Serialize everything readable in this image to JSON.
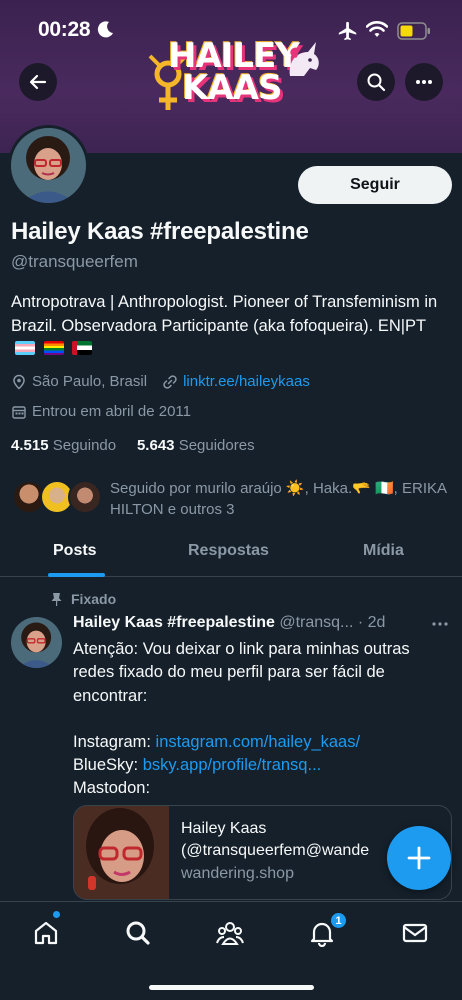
{
  "status_bar": {
    "time": "00:28"
  },
  "banner": {
    "logo_line1": "HAILEY",
    "logo_line2": "KAAS"
  },
  "profile": {
    "follow_label": "Seguir",
    "display_name": "Hailey Kaas #freepalestine",
    "handle": "@transqueerfem",
    "bio": "Antropotrava | Anthropologist. Pioneer of Transfeminism in Brazil. Observadora Participante (aka fofoqueira). EN|PT",
    "location": "São Paulo, Brasil",
    "link": "linktr.ee/haileykaas",
    "joined": "Entrou em abril de 2011",
    "following_count": "4.515",
    "following_label": "Seguindo",
    "followers_count": "5.643",
    "followers_label": "Seguidores",
    "followed_by": "Seguido por murilo araújo ☀️, Haka.🫳 🇮🇪, ERIKA HILTON e outros 3"
  },
  "tabs": [
    {
      "label": "Posts"
    },
    {
      "label": "Respostas"
    },
    {
      "label": "Mídia"
    }
  ],
  "tweet": {
    "pinned_label": "Fixado",
    "name": "Hailey Kaas #freepalestine",
    "handle_time": "@transq... · 2d",
    "line1": "Atenção: Vou deixar o link para minhas outras redes fixado do meu perfil para ser fácil de encontrar:",
    "instagram_label": "Instagram: ",
    "instagram_link": "instagram.com/hailey_kaas/",
    "bluesky_label": "BlueSky: ",
    "bluesky_link": "bsky.app/profile/transq...",
    "mastodon_label": "Mastodon:",
    "card_title_1": "Hailey Kaas",
    "card_title_2": "(@transqueerfem@wande",
    "card_domain": "wandering.shop"
  },
  "bottom_nav": {
    "notif_count": "1"
  },
  "colors": {
    "accent": "#1d9bf0",
    "background": "#15202b",
    "muted": "#8b98a5"
  }
}
